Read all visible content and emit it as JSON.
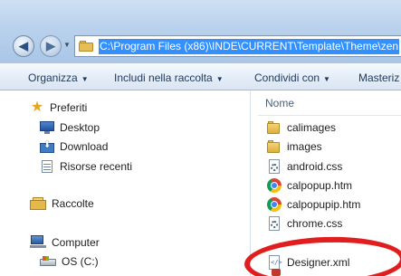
{
  "address": {
    "path": "C:\\Program Files (x86)\\INDE\\CURRENT\\Template\\Theme\\zen"
  },
  "navigation": {
    "back_icon": "back-arrow-icon",
    "forward_icon": "forward-arrow-icon"
  },
  "toolbar": {
    "organize": "Organizza",
    "include": "Includi nella raccolta",
    "share": "Condividi con",
    "more": "Masteriz"
  },
  "nav_pane": {
    "favorites": "Preferiti",
    "desktop": "Desktop",
    "download": "Download",
    "recent": "Risorse recenti",
    "libraries": "Raccolte",
    "computer": "Computer",
    "drive_c": "OS (C:)"
  },
  "file_list": {
    "column_name": "Nome",
    "files": [
      {
        "name": "calimages",
        "icon": "folder-icon"
      },
      {
        "name": "images",
        "icon": "folder-icon"
      },
      {
        "name": "android.css",
        "icon": "css-file-icon"
      },
      {
        "name": "calpopup.htm",
        "icon": "chrome-icon"
      },
      {
        "name": "calpopupip.htm",
        "icon": "chrome-icon"
      },
      {
        "name": "chrome.css",
        "icon": "css-file-icon"
      },
      {
        "name": "Designer.xml",
        "icon": "xml-file-icon"
      }
    ]
  },
  "annotation": {
    "color": "#e11e1e"
  }
}
